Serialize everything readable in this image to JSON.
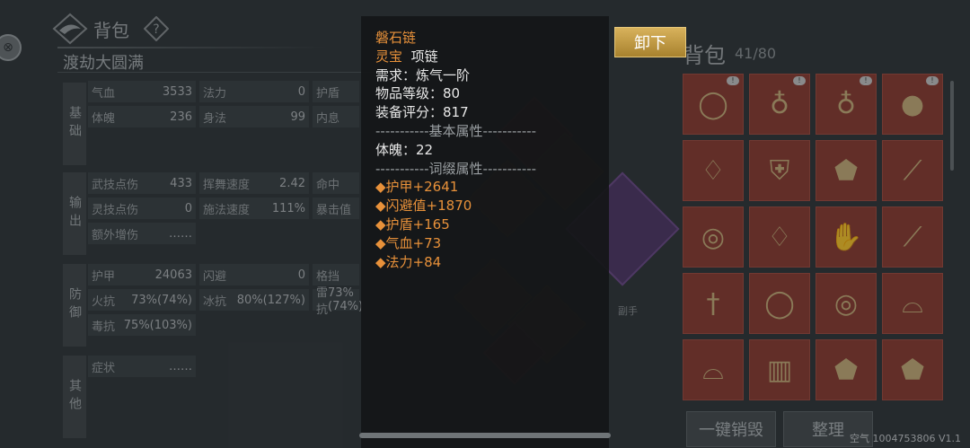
{
  "header": {
    "title": "背包",
    "help_glyph": "?",
    "realm": "渡劫大圆满"
  },
  "stats": {
    "sections": [
      {
        "label": "基础",
        "key": "basic"
      },
      {
        "label": "输出",
        "key": "output"
      },
      {
        "label": "防御",
        "key": "defense"
      },
      {
        "label": "其他",
        "key": "other"
      }
    ],
    "basic": [
      {
        "name": "气血",
        "value": "3533"
      },
      {
        "name": "法力",
        "value": "0"
      },
      {
        "name": "护盾",
        "value": ""
      },
      {
        "name": "体魄",
        "value": "236"
      },
      {
        "name": "身法",
        "value": "99"
      },
      {
        "name": "内息",
        "value": ""
      }
    ],
    "output": [
      {
        "name": "武技点伤",
        "value": "433"
      },
      {
        "name": "挥舞速度",
        "value": "2.42"
      },
      {
        "name": "命中",
        "value": ""
      },
      {
        "name": "灵技点伤",
        "value": "0"
      },
      {
        "name": "施法速度",
        "value": "111%"
      },
      {
        "name": "暴击值",
        "value": ""
      },
      {
        "name": "额外增伤",
        "value": "……"
      }
    ],
    "defense": [
      {
        "name": "护甲",
        "value": "24063"
      },
      {
        "name": "闪避",
        "value": "0"
      },
      {
        "name": "格挡",
        "value": ""
      },
      {
        "name": "火抗",
        "value": "73%(74%)"
      },
      {
        "name": "冰抗",
        "value": "80%(127%)"
      },
      {
        "name": "雷抗",
        "value": "73%(74%)"
      },
      {
        "name": "毒抗",
        "value": "75%(103%)"
      }
    ],
    "other": [
      {
        "name": "症状",
        "value": "……"
      }
    ]
  },
  "equipment": {
    "offhand_label": "副手"
  },
  "bag": {
    "title": "背包",
    "count": "41/80",
    "destroy_label": "一键销毁",
    "sort_label": "整理",
    "items": [
      {
        "icon": "bracelet-icon",
        "badge": true
      },
      {
        "icon": "amulet-icon",
        "badge": true
      },
      {
        "icon": "amulet-icon",
        "badge": true
      },
      {
        "icon": "orb-icon",
        "badge": true
      },
      {
        "icon": "necklace-icon",
        "badge": false
      },
      {
        "icon": "armor-icon",
        "badge": false
      },
      {
        "icon": "shield-icon",
        "badge": false
      },
      {
        "icon": "blade-icon",
        "badge": false
      },
      {
        "icon": "ring-icon",
        "badge": false
      },
      {
        "icon": "necklace-icon",
        "badge": false
      },
      {
        "icon": "gloves-icon",
        "badge": false
      },
      {
        "icon": "blade-icon",
        "badge": false
      },
      {
        "icon": "dagger-icon",
        "badge": false
      },
      {
        "icon": "bracelet-icon",
        "badge": false
      },
      {
        "icon": "ring-icon",
        "badge": false
      },
      {
        "icon": "helmet-icon",
        "badge": false
      },
      {
        "icon": "helmet-icon",
        "badge": false
      },
      {
        "icon": "bracer-icon",
        "badge": false
      },
      {
        "icon": "shield-icon",
        "badge": false
      },
      {
        "icon": "shield-icon",
        "badge": false
      }
    ]
  },
  "tooltip": {
    "item_name": "磐石链",
    "quality": "灵宝",
    "type": "项链",
    "requirement": "需求：炼气一阶",
    "item_level": "物品等级：80",
    "gear_score": "装备评分：817",
    "base_header": "-----------基本属性-----------",
    "base_attr": "体魄：22",
    "affix_header": "-----------词缀属性-----------",
    "affixes": [
      "◆护甲+2641",
      "◆闪避值+1870",
      "◆护盾+165",
      "◆气血+73",
      "◆法力+84"
    ],
    "unequip_label": "卸下"
  },
  "footer": "空气 1004753806 V1.1"
}
